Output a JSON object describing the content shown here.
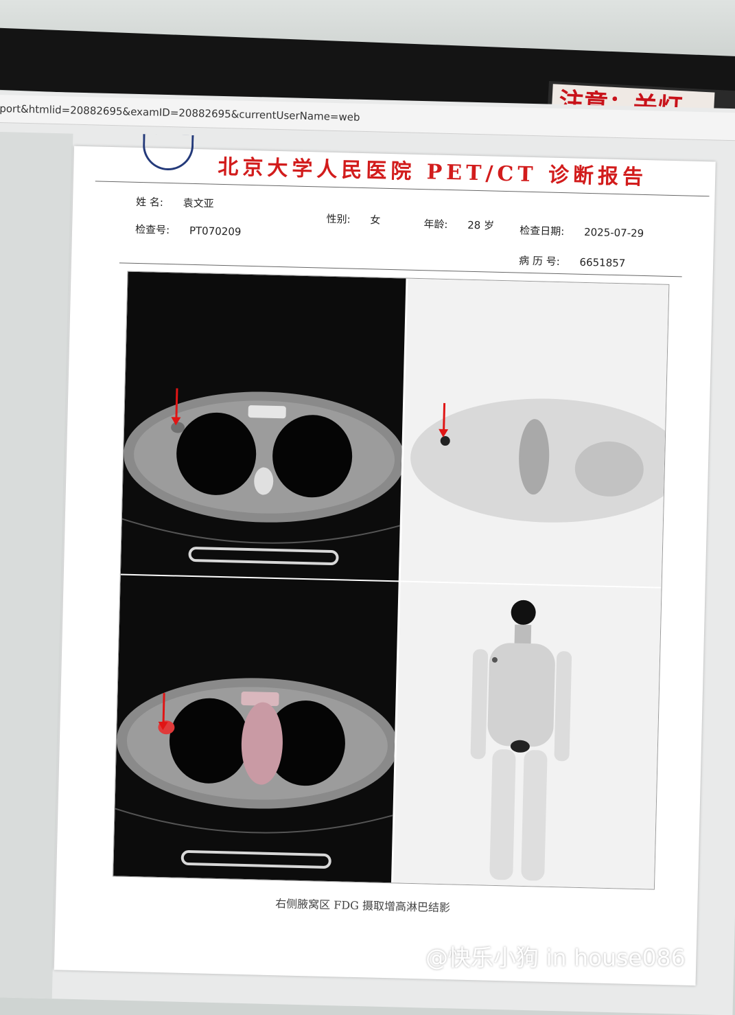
{
  "browser": {
    "url": "port&htmlid=20882695&examID=20882695&currentUserName=web"
  },
  "notice_sign": {
    "text": "注意：关灯、"
  },
  "report": {
    "title": "北京大学人民医院 PET/CT 诊断报告",
    "patient": {
      "name_label": "姓    名:",
      "name_value": "袁文亚",
      "sex_label": "性别:",
      "sex_value": "女",
      "age_label": "年龄:",
      "age_value": "28 岁",
      "exam_no_label": "检查号:",
      "exam_no_value": "PT070209",
      "exam_date_label": "检查日期:",
      "exam_date_value": "2025-07-29",
      "record_no_label": "病 历 号:",
      "record_no_value": "6651857"
    },
    "caption": "右侧腋窝区 FDG 摄取增高淋巴结影"
  },
  "watermark": "@快乐小狗 in house086",
  "colors": {
    "title_red": "#d21c1c",
    "arrow_red": "#e01515",
    "sign_red": "#c8121a"
  }
}
